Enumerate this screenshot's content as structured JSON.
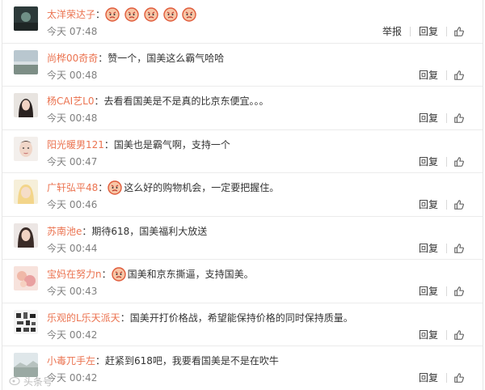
{
  "comments": [
    {
      "user": "太洋荣达子",
      "text": "",
      "emojis": 5,
      "time": "今天 07:48",
      "report": "举报",
      "reply": "回复"
    },
    {
      "user": "尚桦00奇奇",
      "text": "赞一个，国美这么霸气哈哈",
      "emojis": 0,
      "time": "今天 00:48",
      "report": "",
      "reply": "回复"
    },
    {
      "user": "杨CAI艺L0",
      "text": "去看看国美是不是真的比京东便宜。。。",
      "emojis": 0,
      "time": "今天 00:48",
      "report": "",
      "reply": "回复"
    },
    {
      "user": "阳光暖男121",
      "text": "国美也是霸气啊，支持一个",
      "emojis": 0,
      "time": "今天 00:47",
      "report": "",
      "reply": "回复"
    },
    {
      "user": "广轩弘平48",
      "text": "这么好的购物机会，一定要把握住。",
      "emojis": 1,
      "time": "今天 00:46",
      "report": "",
      "reply": "回复"
    },
    {
      "user": "苏南池e",
      "text": "期待618，国美福利大放送",
      "emojis": 0,
      "time": "今天 00:44",
      "report": "",
      "reply": "回复"
    },
    {
      "user": "宝妈在努力n",
      "text": "国美和京东撕逼，支持国美。",
      "emojis": 1,
      "time": "今天 00:43",
      "report": "",
      "reply": "回复"
    },
    {
      "user": "乐观的L乐天派天",
      "text": "国美开打价格战，希望能保持价格的同时保持质量。",
      "emojis": 0,
      "time": "今天 00:42",
      "report": "",
      "reply": "回复"
    },
    {
      "user": "小毒兀手左",
      "text": "赶紧到618吧，我要看国美是不是在吹牛",
      "emojis": 0,
      "time": "今天 00:42",
      "report": "",
      "reply": "回复"
    }
  ],
  "icons": {
    "like": "thumbs-up-icon",
    "emoji": "angry-face-emoji-icon",
    "watermark": "weibo-logo-icon"
  },
  "colors": {
    "username": "#eb7350",
    "time": "#808080",
    "divider": "#ebebeb",
    "emoji": "#f08a5d"
  },
  "watermark": "头条号"
}
